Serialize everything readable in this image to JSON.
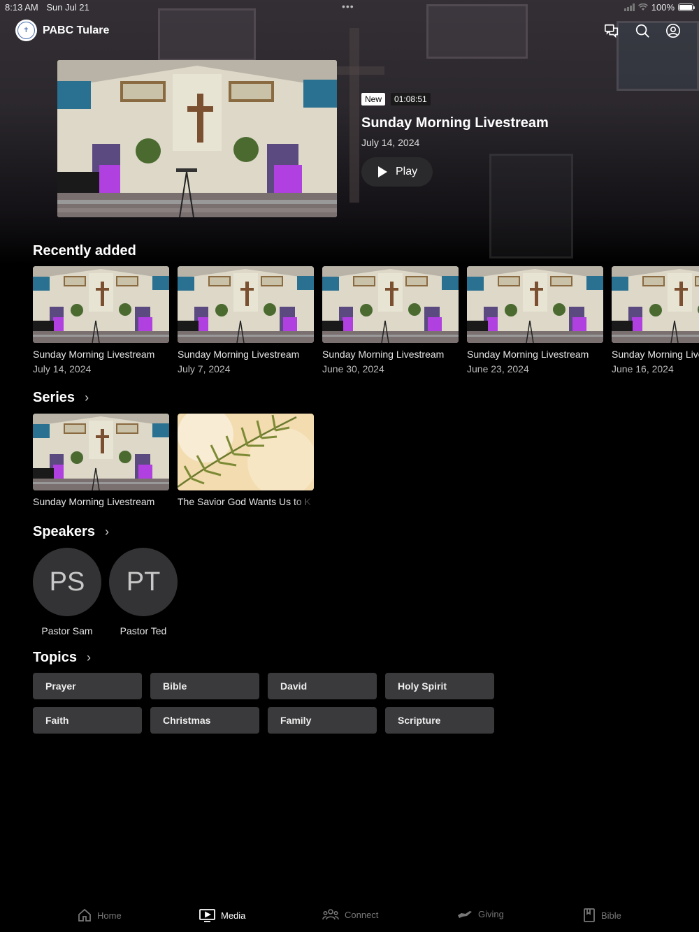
{
  "status_bar": {
    "time": "8:13 AM",
    "date": "Sun Jul 21",
    "battery": "100%"
  },
  "header": {
    "app_title": "PABC Tulare"
  },
  "featured": {
    "badge_new": "New",
    "duration": "01:08:51",
    "title": "Sunday Morning Livestream",
    "date": "July 14, 2024",
    "play_label": "Play"
  },
  "recently_added": {
    "title": "Recently added",
    "items": [
      {
        "title": "Sunday Morning Livestream",
        "date": "July 14, 2024"
      },
      {
        "title": "Sunday Morning Livestream",
        "date": "July 7, 2024"
      },
      {
        "title": "Sunday Morning Livestream",
        "date": "June 30, 2024"
      },
      {
        "title": "Sunday Morning Livestream",
        "date": "June 23, 2024"
      },
      {
        "title": "Sunday Morning Livestream",
        "date": "June 16, 2024"
      }
    ]
  },
  "series": {
    "title": "Series",
    "items": [
      {
        "title": "Sunday Morning Livestream"
      },
      {
        "title": "The Savior God Wants Us to K"
      }
    ]
  },
  "speakers": {
    "title": "Speakers",
    "items": [
      {
        "initials": "PS",
        "name": "Pastor Sam"
      },
      {
        "initials": "PT",
        "name": "Pastor Ted"
      }
    ]
  },
  "topics": {
    "title": "Topics",
    "items": [
      "Prayer",
      "Bible",
      "David",
      "Holy Spirit",
      "Faith",
      "Christmas",
      "Family",
      "Scripture"
    ]
  },
  "tabbar": {
    "items": [
      {
        "label": "Home",
        "icon": "home-icon"
      },
      {
        "label": "Media",
        "icon": "media-icon",
        "active": true
      },
      {
        "label": "Connect",
        "icon": "connect-icon"
      },
      {
        "label": "Giving",
        "icon": "giving-icon"
      },
      {
        "label": "Bible",
        "icon": "bible-icon"
      }
    ]
  },
  "colors": {
    "background": "#000000",
    "chip": "#3a3a3c",
    "avatar": "#333335",
    "play_button": "#2a2a2c"
  }
}
